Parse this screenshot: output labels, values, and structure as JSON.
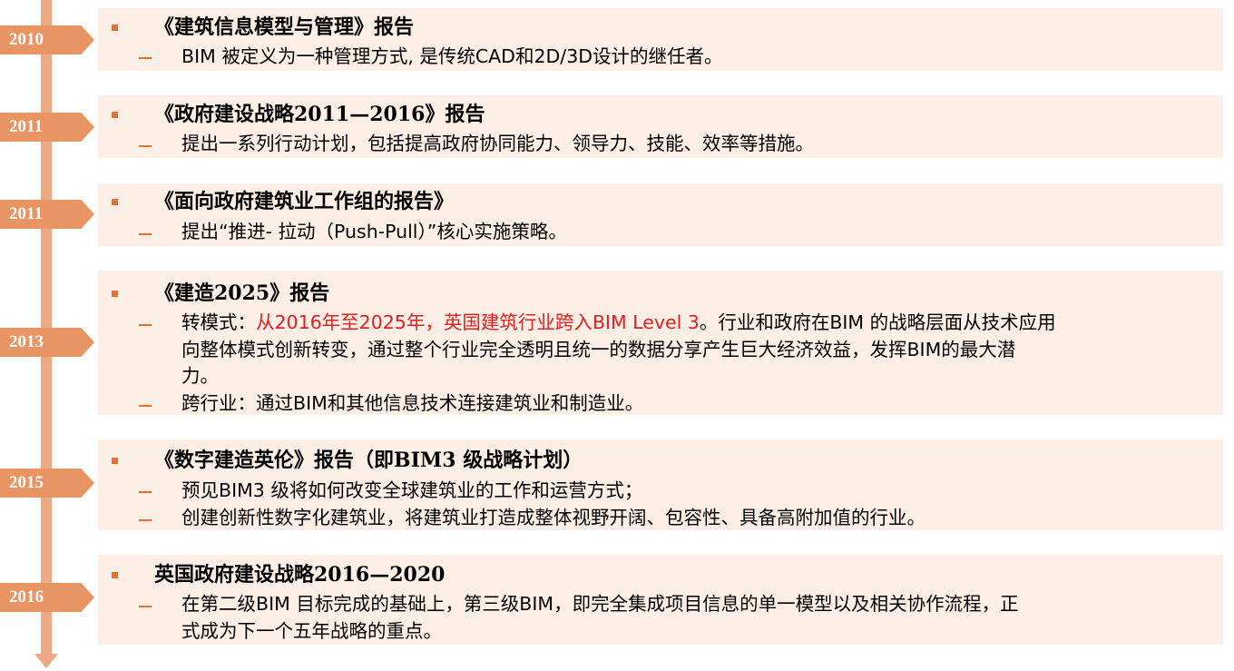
{
  "timeline": [
    {
      "year": "2010",
      "title": "《建筑信息模型与管理》报告",
      "items": [
        "BIM 被定义为一种管理方式, 是传统CAD和2D/3D设计的继任者。"
      ]
    },
    {
      "year": "2011",
      "title": "《政府建设战略2011—2016》报告",
      "items": [
        "提出一系列行动计划，包括提高政府协同能力、领导力、技能、效率等措施。"
      ]
    },
    {
      "year": "2011",
      "title": "《面向政府建筑业工作组的报告》",
      "items": [
        "提出“推进- 拉动（Push-Pull）”核心实施策略。"
      ]
    },
    {
      "year": "2013",
      "title": "《建造2025》报告",
      "item1_prefix": "转模式：",
      "item1_highlight": "从2016年至2025年，英国建筑行业跨入BIM Level 3",
      "item1_rest": "。行业和政府在BIM 的战略层面从技术应用",
      "item1_line2": "向整体模式创新转变，通过整个行业完全透明且统一的数据分享产生巨大经济效益，发挥BIM的最大潜",
      "item1_line3": "力。",
      "item2": "跨行业：通过BIM和其他信息技术连接建筑业和制造业。"
    },
    {
      "year": "2015",
      "title": "《数字建造英伦》报告（即BIM3 级战略计划）",
      "items": [
        "预见BIM3 级将如何改变全球建筑业的工作和运营方式；",
        "创建创新性数字化建筑业，将建筑业打造成整体视野开阔、包容性、具备高附加值的行业。"
      ]
    },
    {
      "year": "2016",
      "title": "英国政府建设战略2016—2020",
      "item1_line1": "在第二级BIM 目标完成的基础上，第三级BIM，即完全集成项目信息的单一模型以及相关协作流程，正",
      "item1_line2": "式成为下一个五年战略的重点。"
    }
  ],
  "colors": {
    "accent": "#e99563",
    "axis": "#eda984",
    "card_background": "#fdeee6",
    "bullet": "#e8702a",
    "highlight_text": "#e32020"
  }
}
